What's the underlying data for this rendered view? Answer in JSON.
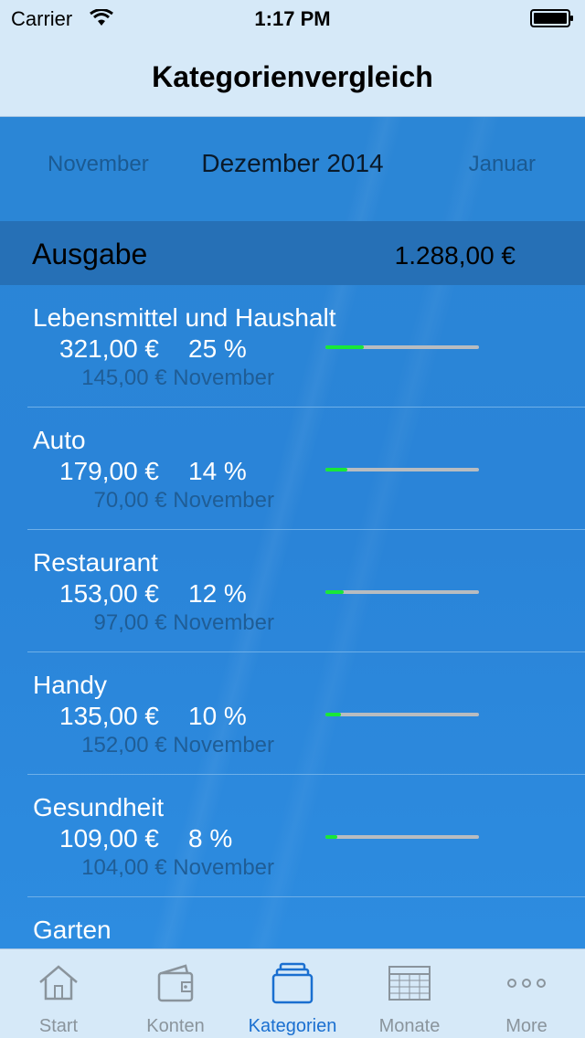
{
  "status_bar": {
    "carrier": "Carrier",
    "time": "1:17 PM"
  },
  "nav": {
    "title": "Kategorienvergleich"
  },
  "month_nav": {
    "previous": "November",
    "current": "Dezember 2014",
    "next": "Januar"
  },
  "section": {
    "title": "Ausgabe",
    "total": "1.288,00 €"
  },
  "categories": [
    {
      "name": "Lebensmittel und Haushalt",
      "amount": "321,00 €",
      "percent": "25 %",
      "share": 0.25,
      "previous": "145,00 € November"
    },
    {
      "name": "Auto",
      "amount": "179,00 €",
      "percent": "14 %",
      "share": 0.14,
      "previous": "70,00 € November"
    },
    {
      "name": "Restaurant",
      "amount": "153,00 €",
      "percent": "12 %",
      "share": 0.12,
      "previous": "97,00 € November"
    },
    {
      "name": "Handy",
      "amount": "135,00 €",
      "percent": "10 %",
      "share": 0.1,
      "previous": "152,00 € November"
    },
    {
      "name": "Gesundheit",
      "amount": "109,00 €",
      "percent": "8 %",
      "share": 0.08,
      "previous": "104,00 € November"
    },
    {
      "name": "Garten"
    }
  ],
  "tabs": [
    {
      "label": "Start",
      "icon": "home-icon"
    },
    {
      "label": "Konten",
      "icon": "wallet-icon"
    },
    {
      "label": "Kategorien",
      "icon": "categories-icon",
      "active": true
    },
    {
      "label": "Monate",
      "icon": "calendar-grid-icon"
    },
    {
      "label": "More",
      "icon": "more-icon"
    }
  ],
  "colors": {
    "accent": "#1a6fd0",
    "bar_fill": "#18e838",
    "background": "#2a86d8"
  }
}
